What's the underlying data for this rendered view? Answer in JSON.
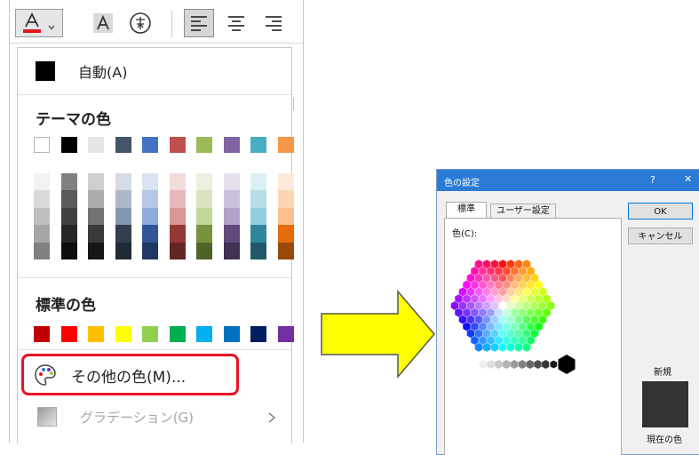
{
  "ribbon": {
    "font_color_icon": "font-color-icon",
    "dropdown_icon": "chevron-down-icon",
    "highlight_icon": "character-shading-icon",
    "enclose_icon": "enclosed-character-icon",
    "align_left_icon": "align-left-icon",
    "align_center_icon": "align-center-icon",
    "align_right_icon": "align-right-icon",
    "font_color_accent": "#e81123"
  },
  "menu": {
    "automatic_label": "自動(A)",
    "automatic_color": "#000000",
    "theme_heading": "テーマの色",
    "theme_top_row": [
      "#ffffff",
      "#000000",
      "#e7e6e6",
      "#44546a",
      "#4472c4",
      "#c0504d",
      "#9bbb59",
      "#8064a2",
      "#4bacc6",
      "#f79646"
    ],
    "theme_shades": [
      [
        "#f2f2f2",
        "#d9d9d9",
        "#bfbfbf",
        "#a6a6a6",
        "#808080"
      ],
      [
        "#808080",
        "#595959",
        "#404040",
        "#262626",
        "#0d0d0d"
      ],
      [
        "#d0cece",
        "#aeaaaa",
        "#757171",
        "#3a3838",
        "#171616"
      ],
      [
        "#d6dce5",
        "#adb9ca",
        "#8497b0",
        "#333f50",
        "#222a35"
      ],
      [
        "#dae3f3",
        "#b4c7e7",
        "#8faadc",
        "#2f5597",
        "#1f3864"
      ],
      [
        "#f2dcdb",
        "#e6b9b8",
        "#d99694",
        "#953735",
        "#632523"
      ],
      [
        "#ebf1de",
        "#d7e4bd",
        "#c3d69b",
        "#77933c",
        "#4f6228"
      ],
      [
        "#e6e0ec",
        "#ccc1da",
        "#b3a2c7",
        "#604a7b",
        "#403152"
      ],
      [
        "#dbeef4",
        "#b7dee8",
        "#93cddd",
        "#31859c",
        "#215968"
      ],
      [
        "#fdeada",
        "#fcd5b5",
        "#fac090",
        "#e46c0a",
        "#984807"
      ]
    ],
    "standard_heading": "標準の色",
    "standard_row": [
      "#c00000",
      "#ff0000",
      "#ffc000",
      "#ffff00",
      "#92d050",
      "#00b050",
      "#00b0f0",
      "#0070c0",
      "#002060",
      "#7030a0"
    ],
    "more_colors_label": "その他の色(M)...",
    "more_colors_icon": "palette-icon",
    "gradient_label": "グラデーション(G)",
    "gradient_icon": "gradient-icon",
    "gradient_arrow_icon": "chevron-right-icon",
    "highlight_box_color": "#e81123"
  },
  "arrow": {
    "fill": "#ffff00",
    "stroke": "#555555",
    "icon": "right-arrow-icon"
  },
  "dialog": {
    "title": "色の設定",
    "help_label": "?",
    "close_label": "✕",
    "tab_standard": "標準",
    "tab_custom": "ユーザー設定",
    "colors_label": "色(C):",
    "ok_label": "OK",
    "cancel_label": "キャンセル",
    "new_label": "新規",
    "current_label": "現在の色",
    "new_color": "#333333",
    "titlebar_color": "#2b7bd6"
  }
}
